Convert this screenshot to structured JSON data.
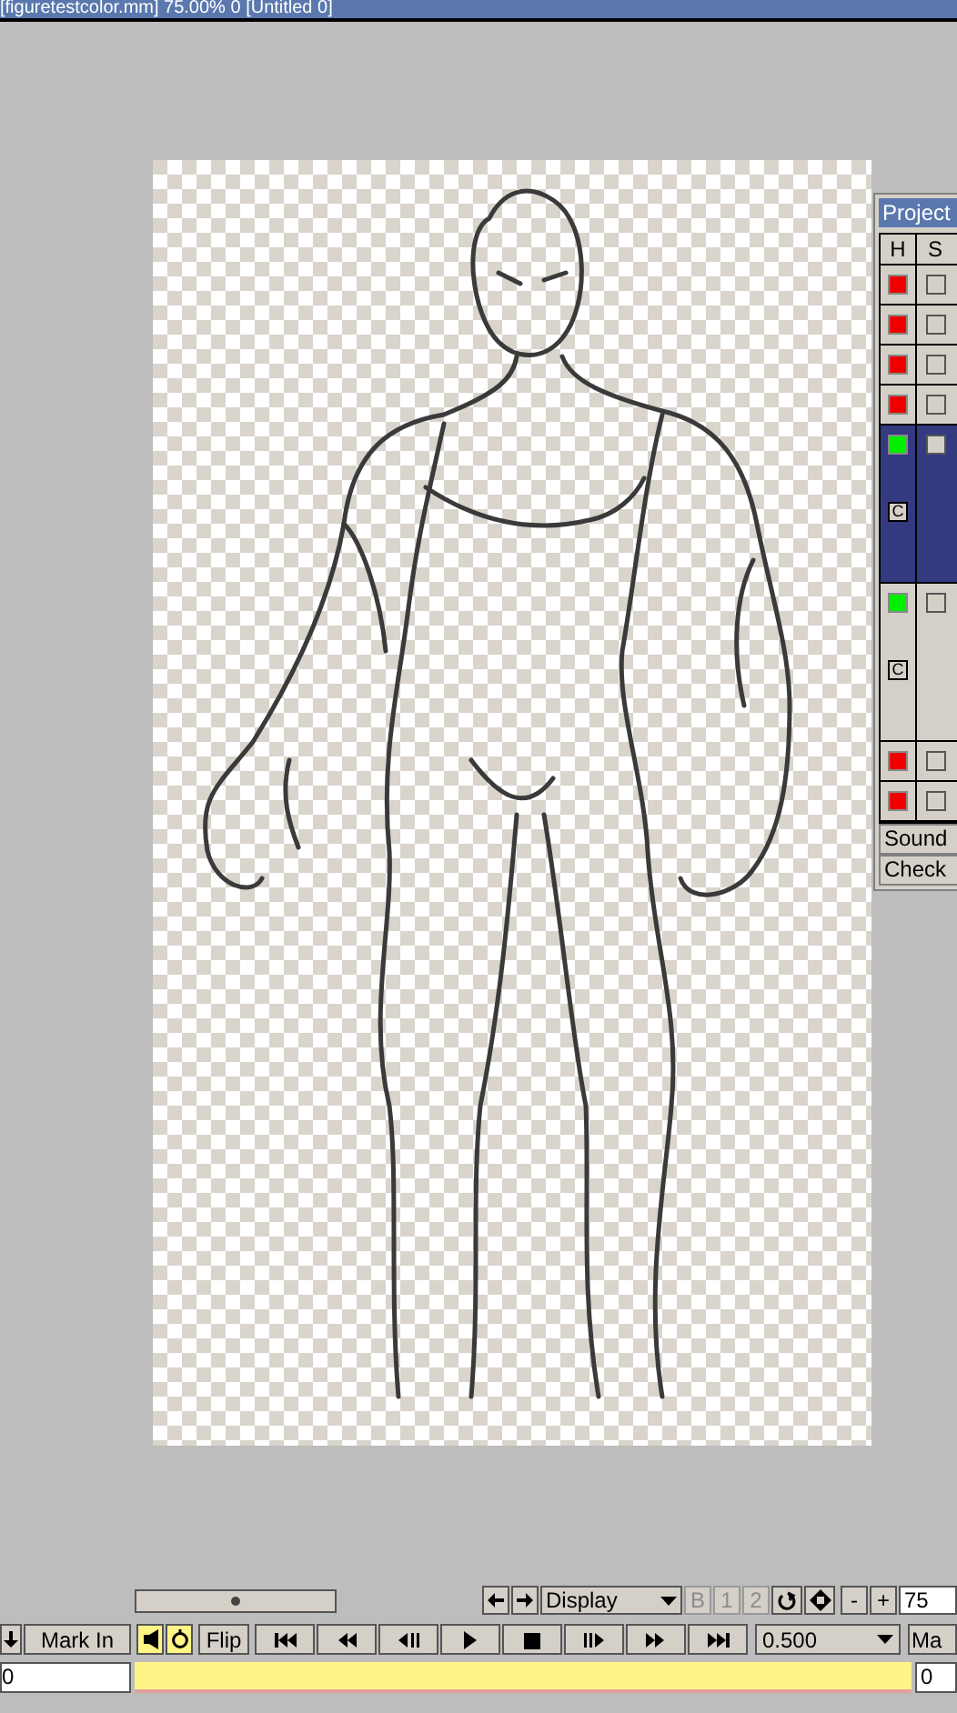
{
  "window": {
    "title": "[figuretestcolor.mm]  75.00%  0  [Untitled 0]"
  },
  "project_panel": {
    "title": "Project",
    "columns": [
      "H",
      "S"
    ],
    "layers": [
      {
        "on": false,
        "checked": false,
        "selected": false
      },
      {
        "on": false,
        "checked": false,
        "selected": false
      },
      {
        "on": false,
        "checked": false,
        "selected": false
      },
      {
        "on": false,
        "checked": false,
        "selected": false
      },
      {
        "on": true,
        "checked": false,
        "selected": true,
        "badge": "C"
      },
      {
        "on": true,
        "checked": false,
        "selected": false,
        "badge": "C"
      },
      {
        "on": false,
        "checked": false,
        "selected": false
      },
      {
        "on": false,
        "checked": false,
        "selected": false
      }
    ],
    "buttons": [
      "Sound",
      "Check"
    ]
  },
  "toolbar": {
    "display": "Display",
    "view_buttons": [
      {
        "label": "B",
        "disabled": true
      },
      {
        "label": "1",
        "disabled": true
      },
      {
        "label": "2",
        "disabled": true
      }
    ],
    "zoom_out": "-",
    "zoom_in": "+",
    "zoom": "75",
    "mark_in": "Mark In",
    "sound_on": true,
    "loop_on": true,
    "flip": "Flip",
    "flip_on": false,
    "speed": "0.500",
    "mark_out": "Ma",
    "start_frame": "0",
    "end_frame": "0"
  }
}
